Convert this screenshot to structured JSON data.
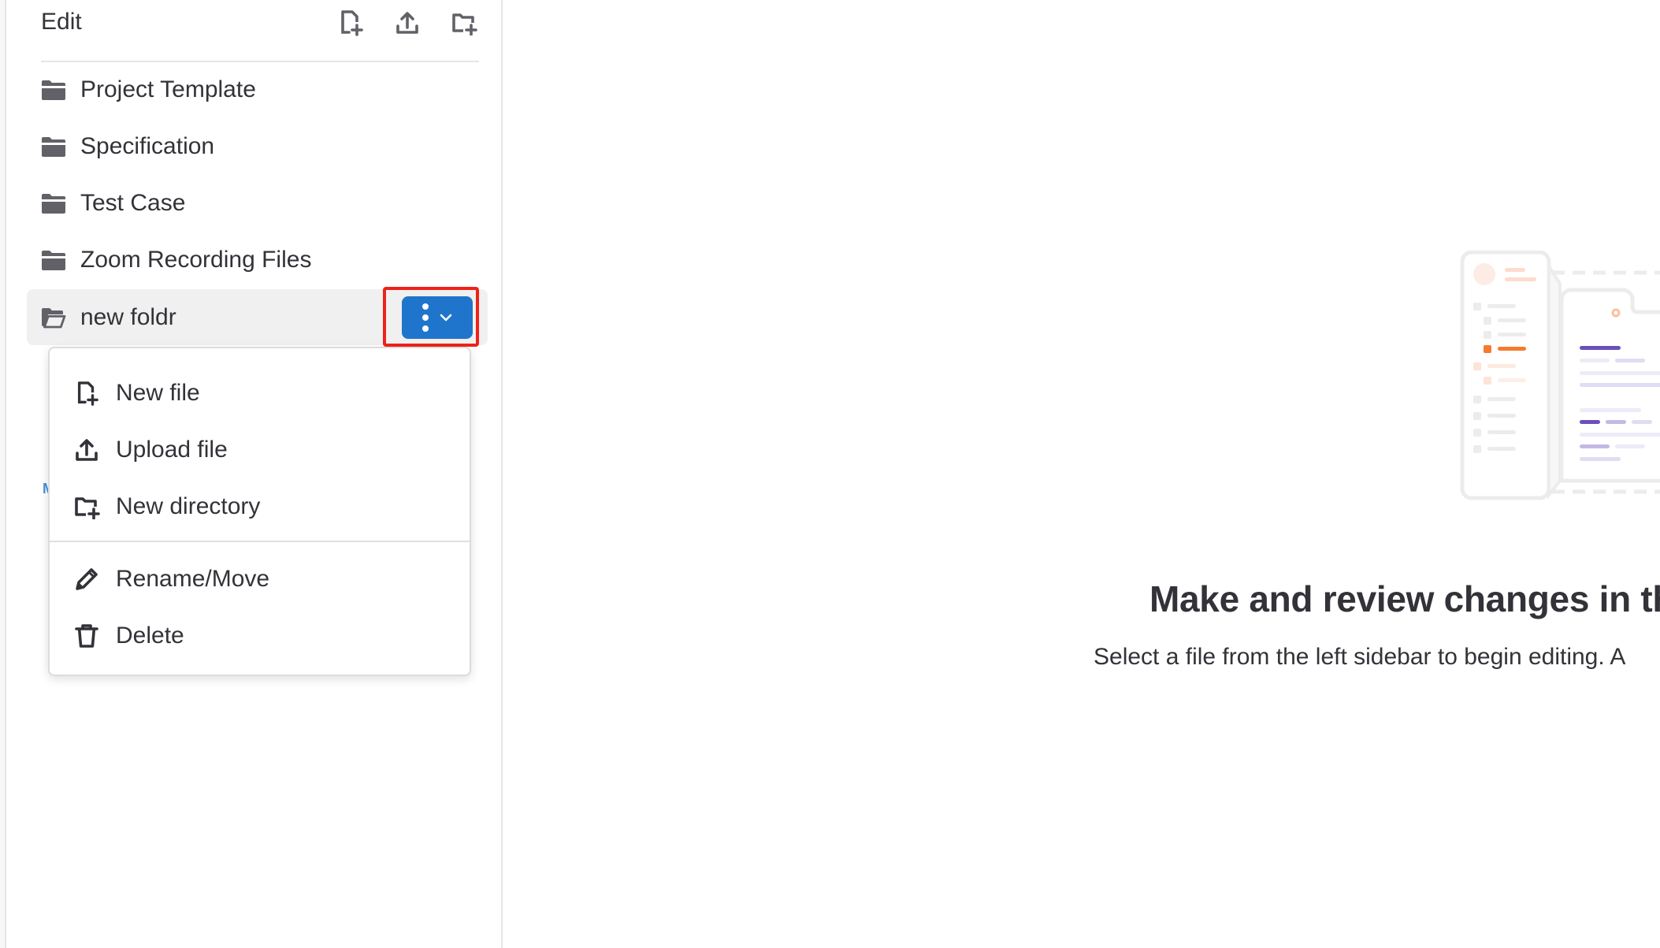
{
  "sidebar": {
    "title": "Edit",
    "header_actions": [
      {
        "name": "new-file",
        "icon": "file-plus-icon",
        "tooltip": "New file"
      },
      {
        "name": "upload-file",
        "icon": "upload-icon",
        "tooltip": "Upload file"
      },
      {
        "name": "new-directory",
        "icon": "folder-plus-icon",
        "tooltip": "New directory"
      }
    ],
    "tree": [
      {
        "label": "Project Template",
        "icon": "folder-icon"
      },
      {
        "label": "Specification",
        "icon": "folder-icon"
      },
      {
        "label": "Test Case",
        "icon": "folder-icon"
      },
      {
        "label": "Zoom Recording Files",
        "icon": "folder-icon"
      },
      {
        "label": "new foldr",
        "icon": "folder-open-icon",
        "active": true
      }
    ],
    "partial_badge": "M"
  },
  "actions_button": {
    "icon": "ellipsis-v-icon",
    "caret": "chevron-down-icon",
    "color": "#1f75cb"
  },
  "highlight_color": "#f0211a",
  "context_menu": {
    "groups": [
      [
        {
          "label": "New file",
          "icon": "file-plus-icon"
        },
        {
          "label": "Upload file",
          "icon": "upload-icon"
        },
        {
          "label": "New directory",
          "icon": "folder-plus-icon"
        }
      ],
      [
        {
          "label": "Rename/Move",
          "icon": "pencil-icon"
        },
        {
          "label": "Delete",
          "icon": "trash-icon"
        }
      ]
    ]
  },
  "empty_state": {
    "title": "Make and review changes in th",
    "description": "Select a file from the left sidebar to begin editing. A"
  }
}
